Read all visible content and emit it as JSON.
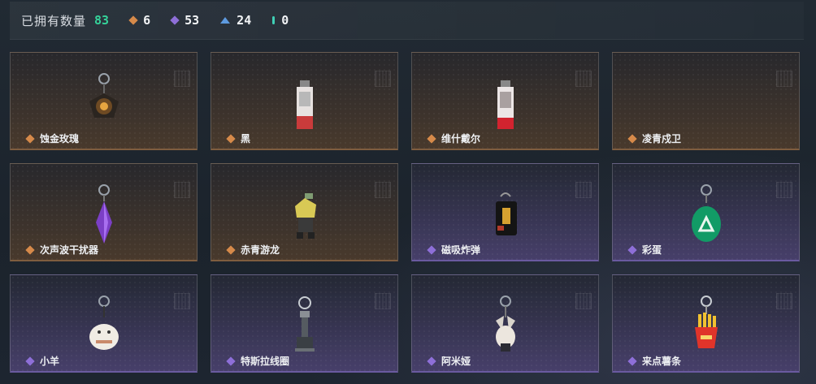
{
  "header": {
    "title": "已拥有数量",
    "owned_count": "83",
    "stats": [
      {
        "icon": "orange-diamond-icon",
        "value": "6",
        "color": "#d68a4a"
      },
      {
        "icon": "purple-diamond-icon",
        "value": "53",
        "color": "#8e6fd8"
      },
      {
        "icon": "blue-triangle-icon",
        "value": "24",
        "color": "#5e9be0"
      },
      {
        "icon": "teal-bar-icon",
        "value": "0",
        "color": "#3fcfb5"
      }
    ]
  },
  "items": [
    {
      "name": "蚀金玫瑰",
      "rarity": "orange",
      "icon": "gold-rose-charm-icon"
    },
    {
      "name": "黑",
      "rarity": "orange",
      "icon": "card-tag-charm-icon"
    },
    {
      "name": "维什戴尔",
      "rarity": "orange",
      "icon": "card-tag-charm-icon"
    },
    {
      "name": "凌青戍卫",
      "rarity": "orange",
      "icon": ""
    },
    {
      "name": "次声波干扰器",
      "rarity": "orange",
      "icon": "purple-crystal-charm-icon"
    },
    {
      "name": "赤青游龙",
      "rarity": "orange",
      "icon": "dragon-figure-charm-icon"
    },
    {
      "name": "磁吸炸弹",
      "rarity": "purple",
      "icon": "bomb-charm-icon"
    },
    {
      "name": "彩蛋",
      "rarity": "purple",
      "icon": "green-egg-charm-icon"
    },
    {
      "name": "小羊",
      "rarity": "purple",
      "icon": "lamb-charm-icon"
    },
    {
      "name": "特斯拉线圈",
      "rarity": "purple",
      "icon": "tesla-coil-charm-icon"
    },
    {
      "name": "阿米娅",
      "rarity": "purple",
      "icon": "amiya-figure-charm-icon"
    },
    {
      "name": "来点薯条",
      "rarity": "purple",
      "icon": "fries-charm-icon"
    }
  ],
  "colors": {
    "orange": "#d68a4a",
    "purple": "#8e6fd8"
  }
}
